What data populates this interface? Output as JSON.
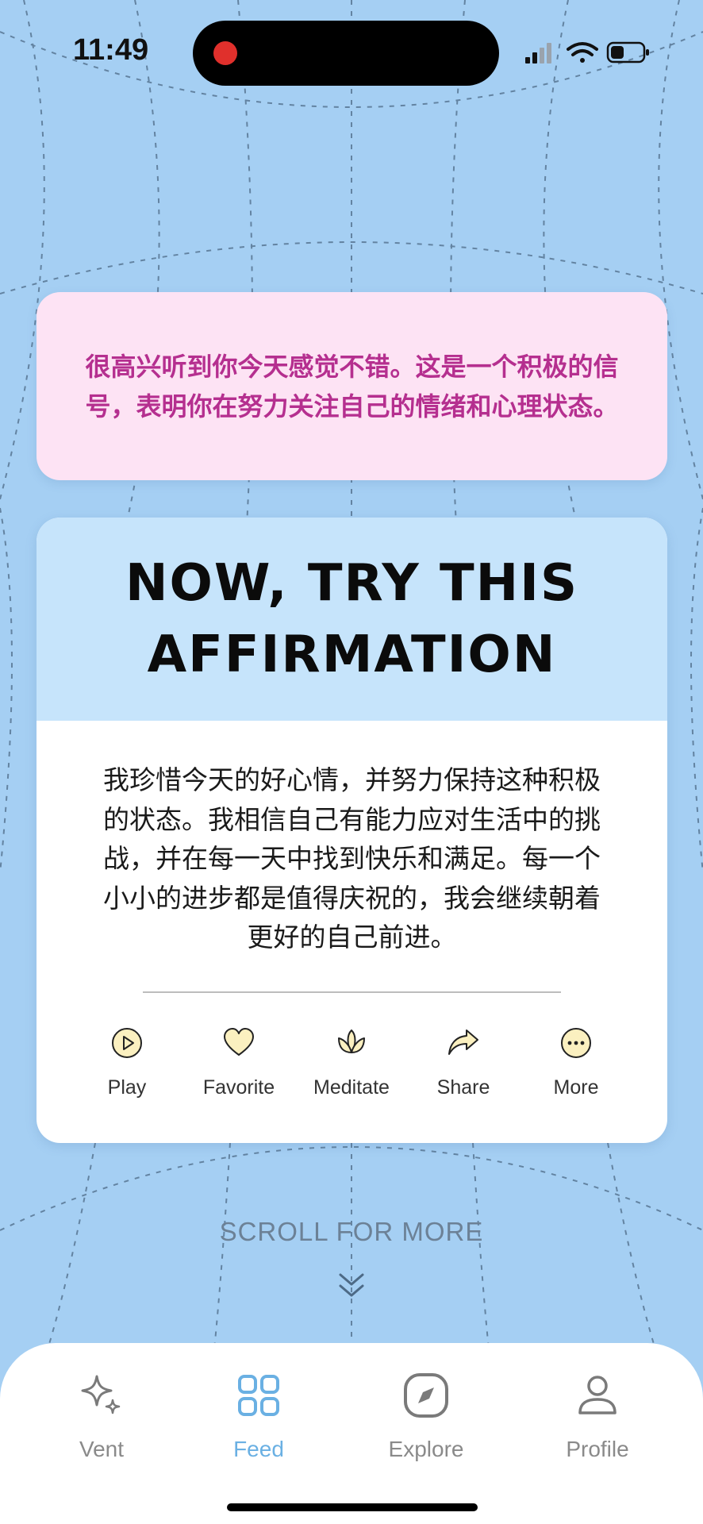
{
  "status_bar": {
    "time": "11:49"
  },
  "message": {
    "text": "很高兴听到你今天感觉不错。这是一个积极的信号，表明你在努力关注自己的情绪和心理状态。"
  },
  "affirmation": {
    "title": "NOW, TRY THIS AFFIRMATION",
    "text": "我珍惜今天的好心情，并努力保持这种积极的状态。我相信自己有能力应对生活中的挑战，并在每一天中找到快乐和满足。每一个小小的进步都是值得庆祝的，我会继续朝着更好的自己前进。",
    "actions": [
      {
        "label": "Play",
        "icon": "play-icon"
      },
      {
        "label": "Favorite",
        "icon": "heart-icon"
      },
      {
        "label": "Meditate",
        "icon": "lotus-icon"
      },
      {
        "label": "Share",
        "icon": "share-arrow-icon"
      },
      {
        "label": "More",
        "icon": "more-dots-icon"
      }
    ]
  },
  "scroll_hint": {
    "text": "SCROLL FOR MORE"
  },
  "nav": {
    "items": [
      {
        "label": "Vent",
        "icon": "sparkle-icon",
        "active": false
      },
      {
        "label": "Feed",
        "icon": "grid-icon",
        "active": true
      },
      {
        "label": "Explore",
        "icon": "compass-icon",
        "active": false
      },
      {
        "label": "Profile",
        "icon": "person-icon",
        "active": false
      }
    ]
  },
  "colors": {
    "background": "#a5cff3",
    "message_bg": "#fde3f4",
    "message_text": "#b52f8f",
    "affirm_header_bg": "#c6e4fb",
    "icon_fill": "#fbf0c0",
    "nav_active": "#6ab0e3"
  }
}
